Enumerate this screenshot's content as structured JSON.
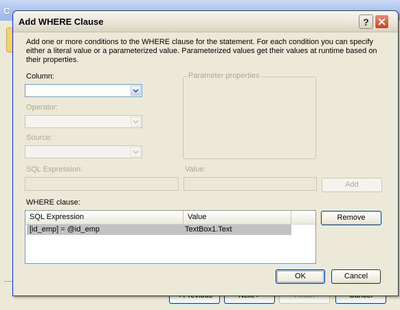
{
  "background_window": {
    "title_fragment": "C",
    "buttons": {
      "previous": "< Previous",
      "next": "Next >",
      "finish": "Finish",
      "cancel": "Cancel"
    }
  },
  "dialog": {
    "title": "Add WHERE Clause",
    "help_label": "?",
    "description": "Add one or more conditions to the WHERE clause for the statement. For each condition you can specify either a literal value or a parameterized value. Parameterized values get their values at runtime based on their properties.",
    "column_label": "Column:",
    "column_value": "",
    "operator_label": "Operator:",
    "operator_value": "",
    "source_label": "Source:",
    "source_value": "",
    "parameter_properties_label": "Parameter properties",
    "sql_expression_label": "SQL Expression:",
    "sql_expression_value": "",
    "value_label": "Value:",
    "value_value": "",
    "add_button": "Add",
    "where_clause_label": "WHERE clause:",
    "where_list": {
      "columns": [
        "SQL Expression",
        "Value"
      ],
      "rows": [
        {
          "sql_expression": "[id_emp] = @id_emp",
          "value": "TextBox1.Text"
        }
      ]
    },
    "remove_button": "Remove",
    "ok_button": "OK",
    "cancel_button": "Cancel"
  },
  "colors": {
    "dialog_background": "#ece9d8",
    "button_border": "#003c74",
    "disabled_text": "#aca899",
    "selected_row": "#c2c2c2",
    "close_button": "#c6452b"
  },
  "icons": {
    "dropdown": "chevron-down-icon",
    "close": "close-icon",
    "help": "help-icon"
  }
}
